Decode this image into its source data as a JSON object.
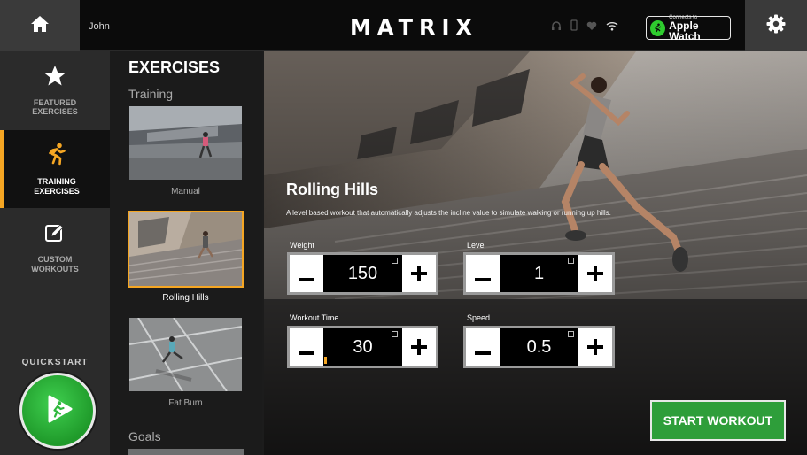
{
  "topbar": {
    "user_name": "John",
    "brand": "MATRIX",
    "watch_small": "Connects to",
    "watch_main": "Apple Watch",
    "icons": [
      "home-icon",
      "headphones-icon",
      "phone-icon",
      "heart-icon",
      "wifi-icon",
      "gear-icon"
    ]
  },
  "nav": {
    "items": [
      {
        "label": "FEATURED EXERCISES",
        "icon": "star-icon",
        "active": false
      },
      {
        "label": "TRAINING EXERCISES",
        "icon": "runner-icon",
        "active": true
      },
      {
        "label": "CUSTOM WORKOUTS",
        "icon": "edit-icon",
        "active": false
      }
    ],
    "quickstart_label": "QUICKSTART"
  },
  "exercises": {
    "title": "EXERCISES",
    "section_training": "Training",
    "section_goals": "Goals",
    "items": [
      {
        "name": "Manual"
      },
      {
        "name": "Rolling Hills"
      },
      {
        "name": "Fat Burn"
      }
    ]
  },
  "workout": {
    "title": "Rolling Hills",
    "description": "A level based workout that automatically adjusts the incline value to simulate walking or running up hills.",
    "weight_label": "Weight",
    "weight_value": "150",
    "level_label": "Level",
    "level_value": "1",
    "time_label": "Workout Time",
    "time_value": "30",
    "speed_label": "Speed",
    "speed_value": "0.5",
    "start_label": "START WORKOUT"
  },
  "colors": {
    "accent": "#f5a623",
    "start_green": "#2e9e3a",
    "quickstart_green": "#2fb83d"
  }
}
